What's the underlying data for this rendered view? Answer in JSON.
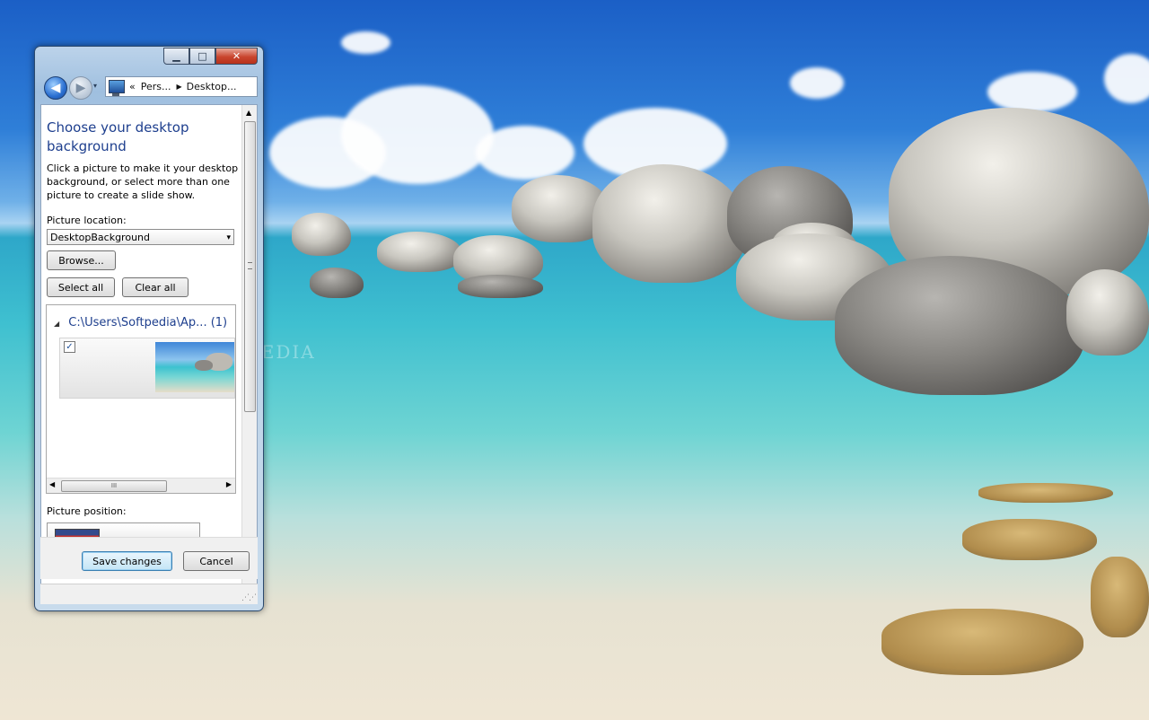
{
  "window": {
    "title_buttons": {
      "minimize": "▁",
      "maximize": "□",
      "close": "✕"
    }
  },
  "nav": {
    "back_icon": "◀",
    "forward_icon": "▶",
    "recent_icon": "▾",
    "address": {
      "overflow_marker": "«",
      "crumbs": [
        "Pers...",
        "Desktop..."
      ],
      "separator": "▶"
    }
  },
  "page": {
    "title": "Choose your desktop background",
    "description": "Click a picture to make it your desktop background, or select more than one picture to create a slide show.",
    "picture_location_label": "Picture location:",
    "picture_location_value": "DesktopBackground",
    "browse_label": "Browse...",
    "select_all_label": "Select all",
    "clear_all_label": "Clear all",
    "group": {
      "path": "C:\\Users\\Softpedia\\Ap...",
      "count": "(1)",
      "items": [
        {
          "checked": true,
          "check_glyph": "✓"
        }
      ]
    },
    "scroll_grip": "III",
    "picture_position_label": "Picture position:"
  },
  "footer": {
    "save_label": "Save changes",
    "cancel_label": "Cancel"
  },
  "desktop": {
    "watermark": "SOFTPEDIA"
  },
  "colors": {
    "title_blue": "#1e3f8e",
    "close_red": "#c9452e"
  }
}
